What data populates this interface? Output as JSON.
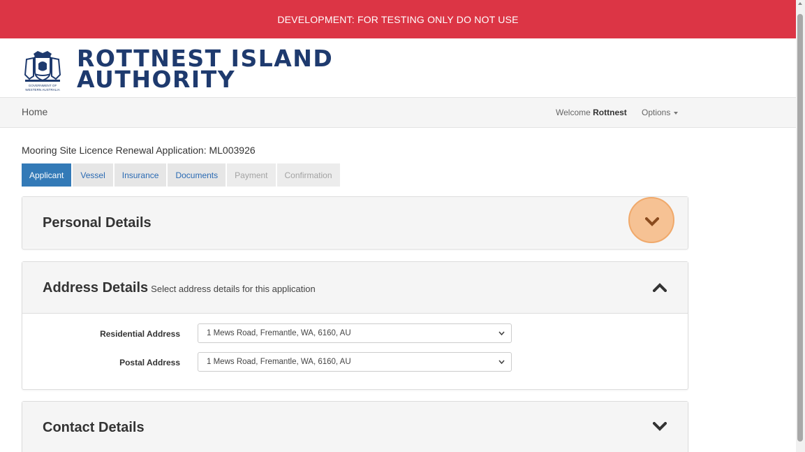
{
  "banner": {
    "text": "DEVELOPMENT: FOR TESTING ONLY DO NOT USE"
  },
  "header": {
    "logo_line1": "ROTTNEST ISLAND",
    "logo_line2": "AUTHORITY",
    "crest_text_1": "GOVERNMENT OF",
    "crest_text_2": "WESTERN AUSTRALIA"
  },
  "navbar": {
    "home": "Home",
    "welcome_prefix": "Welcome",
    "welcome_user": "Rottnest",
    "options": "Options"
  },
  "app_title": "Mooring Site Licence Renewal Application: ML003926",
  "tabs": [
    {
      "label": "Applicant",
      "state": "active"
    },
    {
      "label": "Vessel",
      "state": "enabled"
    },
    {
      "label": "Insurance",
      "state": "enabled"
    },
    {
      "label": "Documents",
      "state": "enabled"
    },
    {
      "label": "Payment",
      "state": "disabled"
    },
    {
      "label": "Confirmation",
      "state": "disabled"
    }
  ],
  "panels": {
    "personal": {
      "title": "Personal Details",
      "icon": "chevron-down-icon",
      "expanded": false
    },
    "address": {
      "title": "Address Details",
      "subtitle": "Select address details for this application",
      "icon": "chevron-up-icon",
      "expanded": true,
      "residential_label": "Residential Address",
      "residential_value": "1 Mews Road, Fremantle, WA, 6160, AU",
      "postal_label": "Postal Address",
      "postal_value": "1 Mews Road, Fremantle, WA, 6160, AU"
    },
    "contact": {
      "title": "Contact Details",
      "icon": "chevron-down-icon",
      "expanded": false
    }
  },
  "colors": {
    "banner": "#dc3545",
    "brand": "#1e3a6e",
    "tab_active": "#337ab7",
    "highlight": "#f6b882"
  }
}
